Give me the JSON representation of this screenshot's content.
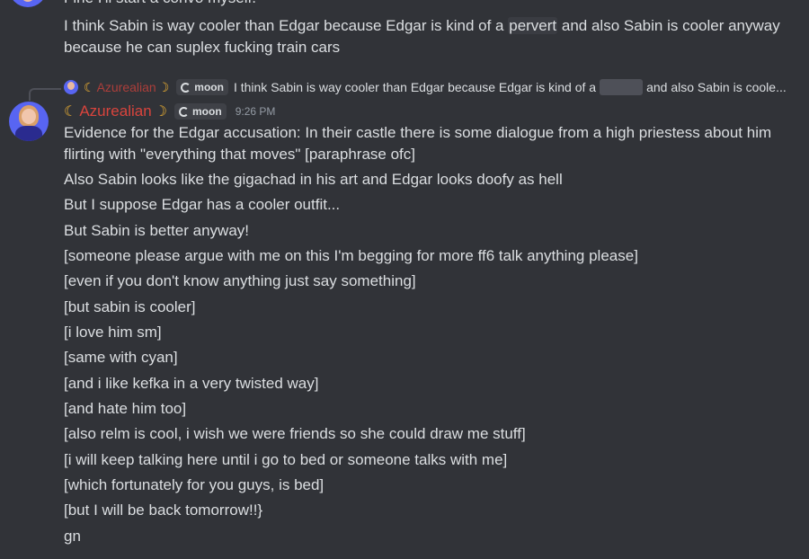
{
  "top_message": {
    "cut_line": "Fine I'll start a convo myself.",
    "line1_before": "I think Sabin is way cooler than Edgar because Edgar is kind of a ",
    "line1_spoiler": "pervert",
    "line1_after": " and also Sabin is cooler anyway",
    "line2": "because he can suplex fucking train cars"
  },
  "reply": {
    "moon_left": "☾",
    "username": "Azurealian",
    "moon_right": "☽",
    "tag": "moon",
    "text_before": "I think Sabin is way cooler than Edgar because Edgar is kind of a",
    "text_after": "and also Sabin is coole..."
  },
  "message": {
    "moon_left": "☾",
    "username": "Azurealian",
    "moon_right": "☽",
    "tag": "moon",
    "timestamp": "9:26 PM",
    "lines": [
      "Evidence for the Edgar accusation: In their castle there is some dialogue from a high priestess about him",
      "flirting with \"everything that moves\" [paraphrase ofc]",
      "Also Sabin looks like the gigachad in his art and Edgar looks doofy as hell",
      "But I suppose Edgar has a cooler outfit...",
      "But Sabin is better anyway!",
      "[someone please argue with me on this I'm begging for more ff6 talk anything please]",
      "[even if you don't know anything just say something]",
      "[but sabin is cooler]",
      "[i love him sm]",
      "[same with cyan]",
      "[and i like kefka in a very twisted way]",
      "[and hate him too]",
      "[also relm is cool, i wish we were friends so she could draw me stuff]",
      "[i will keep talking here until i go to bed or someone talks with me]",
      "[which fortunately for you guys, is bed]",
      "[but I will be back tomorrow!!}",
      "gn"
    ]
  },
  "colors": {
    "background": "#313338",
    "username": "#d9443d",
    "text": "#dbdee1",
    "muted": "#949ba4"
  },
  "icons": {
    "avatar": "user-avatar",
    "tag_icon": "moon-icon"
  }
}
